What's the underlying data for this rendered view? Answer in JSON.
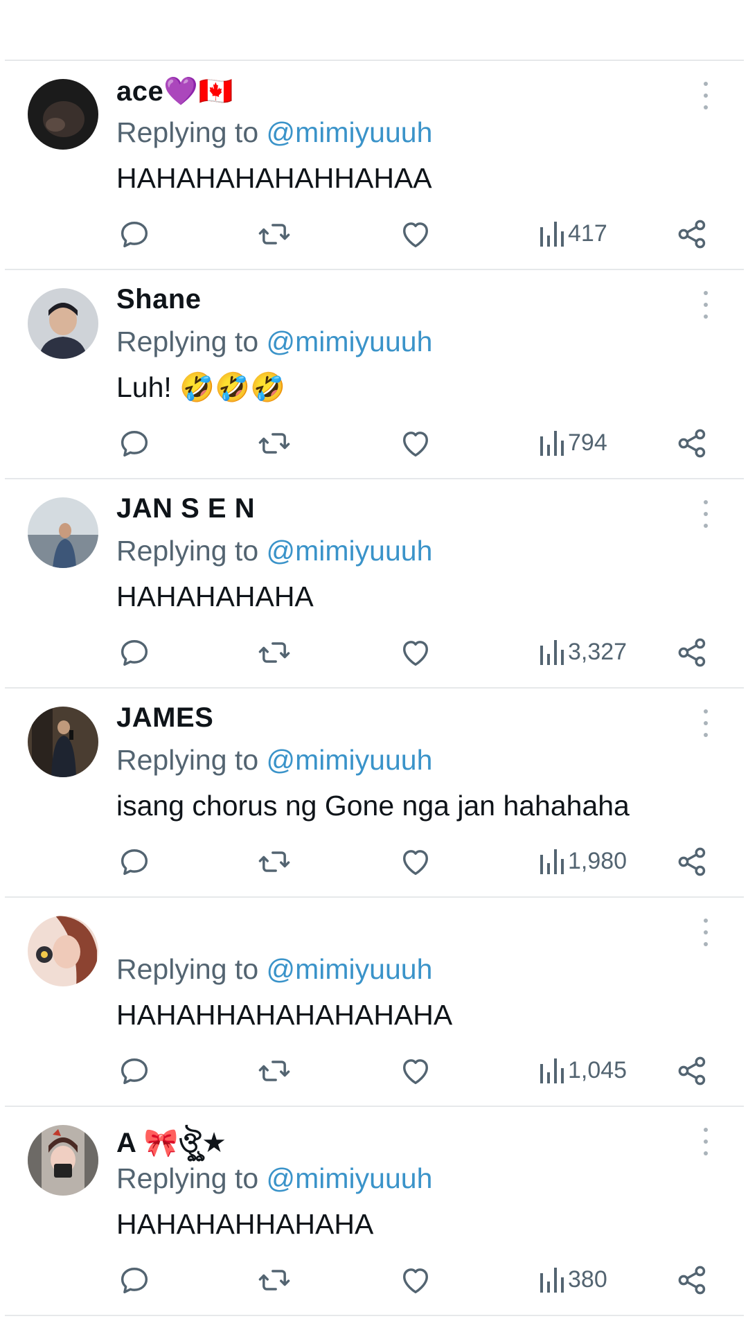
{
  "replying_prefix": "Replying to ",
  "replies": [
    {
      "name": "ace💜🇨🇦",
      "handle": "@mimiyuuuh",
      "text": "HAHAHAHAHAHHAHAA",
      "views": "417",
      "avatar_colors": [
        "#2a2220",
        "#111111"
      ]
    },
    {
      "name": "Shane",
      "handle": "@mimiyuuuh",
      "text": "Luh! 🤣🤣🤣",
      "views": "794",
      "avatar_colors": [
        "#c9ccd1",
        "#2a2d36"
      ]
    },
    {
      "name": "JAN S E  N",
      "handle": "@mimiyuuuh",
      "text": "HAHAHAHAHA",
      "views": "3,327",
      "avatar_colors": [
        "#c7d0d6",
        "#3b4c66"
      ]
    },
    {
      "name": "JAMES",
      "handle": "@mimiyuuuh",
      "text": "isang chorus ng Gone nga jan hahahaha",
      "views": "1,980",
      "avatar_colors": [
        "#5b4b3c",
        "#1c1a1a"
      ]
    },
    {
      "name": "",
      "handle": "@mimiyuuuh",
      "text": "HAHAHHAHAHAHAHAHA",
      "views": "1,045",
      "avatar_colors": [
        "#e8c2b5",
        "#8a4a3a"
      ]
    },
    {
      "name": "A 🎀ঔৣ★",
      "handle": "@mimiyuuuh",
      "text": "HAHAHAHHAHAHA",
      "views": "380",
      "avatar_colors": [
        "#d8cfc8",
        "#6b3a35"
      ]
    }
  ],
  "icons": [
    "reply-icon",
    "retweet-icon",
    "like-icon",
    "views-icon",
    "share-icon",
    "more-icon"
  ],
  "colors": {
    "handle": "#3a93c9",
    "secondary": "#536471",
    "divider": "#e6e8ea"
  }
}
